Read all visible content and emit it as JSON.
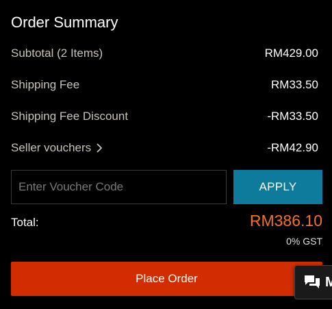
{
  "summary": {
    "title": "Order Summary",
    "subtotal_label": "Subtotal (2 Items)",
    "subtotal_value": "RM429.00",
    "shipping_label": "Shipping Fee",
    "shipping_value": "RM33.50",
    "shipping_discount_label": "Shipping Fee Discount",
    "shipping_discount_value": "-RM33.50",
    "seller_vouchers_label": "Seller vouchers",
    "seller_vouchers_value": "-RM42.90"
  },
  "voucher": {
    "placeholder": "Enter Voucher Code",
    "apply_label": "APPLY"
  },
  "total": {
    "label": "Total:",
    "value": "RM386.10",
    "gst_note": "0% GST"
  },
  "actions": {
    "place_order_label": "Place Order",
    "chat_label": "M"
  },
  "colors": {
    "background": "#000000",
    "accent_orange": "#f57224",
    "place_order_red": "#d12d00",
    "apply_teal": "#0e7a9c"
  },
  "icons": {
    "seller_chevron": "chevron-right-icon",
    "chat": "chat-bubbles-icon"
  }
}
